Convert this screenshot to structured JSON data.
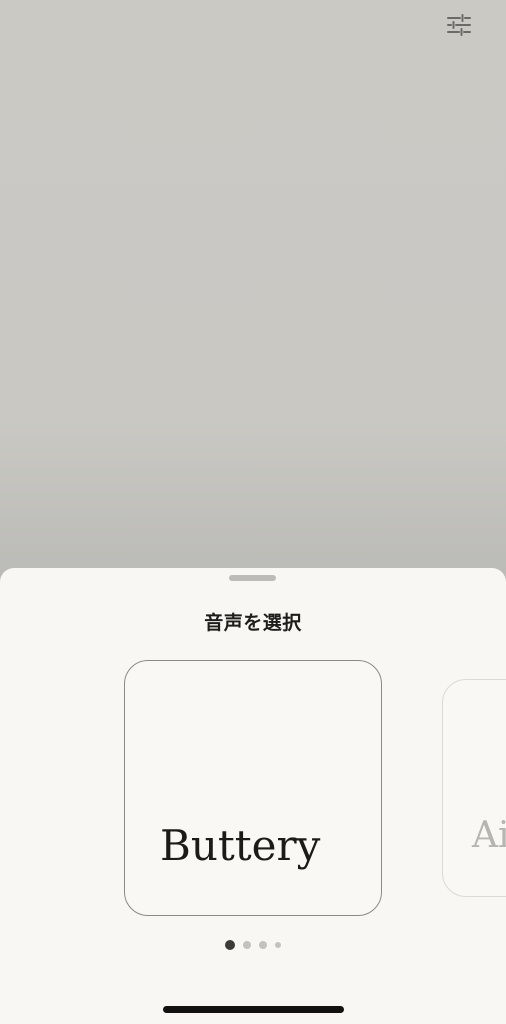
{
  "header": {
    "settings_icon": "sliders-icon"
  },
  "sheet": {
    "title": "音声を選択",
    "voices": [
      {
        "name": "Buttery"
      },
      {
        "name": "Ai"
      }
    ],
    "pagination": {
      "total": 4,
      "current": 1
    }
  },
  "colors": {
    "backdrop": "#cbc9c4",
    "sheet_background": "#f8f7f3",
    "text": "#1d1d1b",
    "active_dot": "#3c3b39",
    "inactive_dot": "#c4c2be"
  }
}
